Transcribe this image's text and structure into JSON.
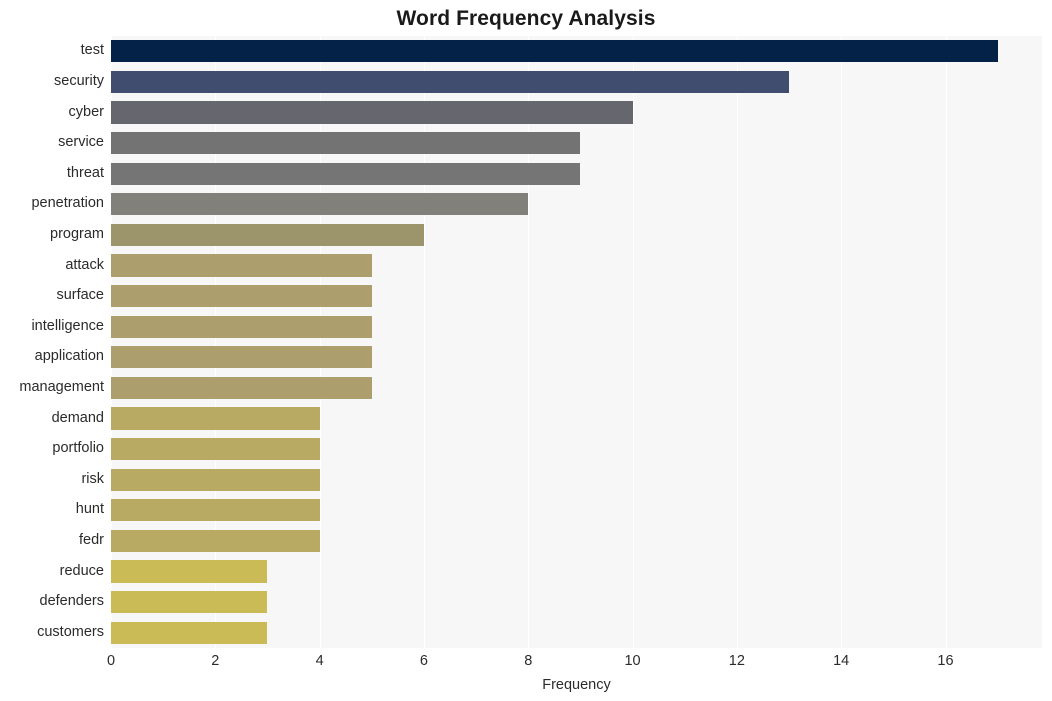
{
  "chart_data": {
    "type": "bar",
    "orientation": "horizontal",
    "title": "Word Frequency Analysis",
    "xlabel": "Frequency",
    "ylabel": "",
    "categories": [
      "test",
      "security",
      "cyber",
      "service",
      "threat",
      "penetration",
      "program",
      "attack",
      "surface",
      "intelligence",
      "application",
      "management",
      "demand",
      "portfolio",
      "risk",
      "hunt",
      "fedr",
      "reduce",
      "defenders",
      "customers"
    ],
    "values": [
      17,
      13,
      10,
      9,
      9,
      8,
      6,
      5,
      5,
      5,
      5,
      5,
      4,
      4,
      4,
      4,
      4,
      3,
      3,
      3
    ],
    "bar_colors": [
      "#042148",
      "#414d6f",
      "#66676e",
      "#737373",
      "#757575",
      "#81807a",
      "#9c956c",
      "#ac9f6d",
      "#ac9f6d",
      "#ac9f6d",
      "#ac9f6d",
      "#ac9f6d",
      "#b8a963",
      "#b8a963",
      "#b8a963",
      "#b8a963",
      "#b8a963",
      "#cbbb56",
      "#cbbb56",
      "#cbbb56"
    ],
    "xlim": [
      0,
      17.85
    ],
    "xticks": [
      0,
      2,
      4,
      6,
      8,
      10,
      12,
      14,
      16
    ],
    "xtick_labels": [
      "0",
      "2",
      "4",
      "6",
      "8",
      "10",
      "12",
      "14",
      "16"
    ],
    "grid": true,
    "grid_axis": "x",
    "grid_color": "#ffffff",
    "plot_background": "#f7f7f7",
    "figure_background": "#ffffff",
    "legend": null,
    "legend_position": "none"
  }
}
